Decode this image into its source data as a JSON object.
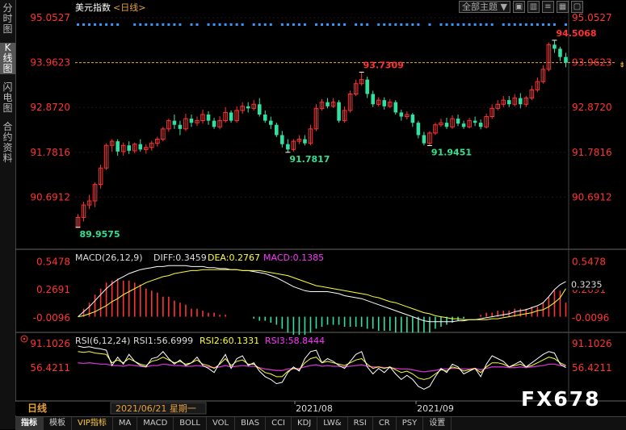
{
  "sidebar": {
    "items": [
      {
        "label": "分时图",
        "active": false
      },
      {
        "label": "K线图",
        "active": true
      },
      {
        "label": "闪电图",
        "active": false
      },
      {
        "label": "合约资料",
        "active": false
      }
    ]
  },
  "header": {
    "instrument": "美元指数",
    "period_tag": "<日线>",
    "theme_select": "全部主题",
    "theme_arrow": "▼"
  },
  "footer": {
    "period": "日线",
    "date_readout": "2021/06/21 星期一",
    "month_labels": [
      "2021/08",
      "2021/09"
    ]
  },
  "bottom_tabs": [
    "指标",
    "模板",
    "VIP指标",
    "MA",
    "MACD",
    "BOLL",
    "VOL",
    "BIAS",
    "CCI",
    "KDJ",
    "LW&",
    "RSI",
    "CR",
    "PSY",
    "设置"
  ],
  "watermark": "FX678",
  "colors": {
    "up": "#ff3333",
    "down": "#33e0a0",
    "up_label": "#ff3333",
    "down_label": "#33e08f",
    "price_axis": "#ff3333",
    "grid": "#3a1a1a",
    "cursor": "#e6a23c",
    "diff": "#ffffff",
    "dea": "#ffff33",
    "macd": "#cc33cc",
    "macd_label": "#ff33ff",
    "rsi1": "#ffffff",
    "rsi2": "#ffff33",
    "rsi3": "#cc33cc"
  },
  "chart_data": [
    {
      "type": "candlestick",
      "yticks": [
        "95.0527",
        "93.9623",
        "92.8720",
        "91.7816",
        "90.6912"
      ],
      "ylim": [
        89.6,
        95.25
      ],
      "last_price_label": "93.9623",
      "annotations": [
        {
          "text": "89.9575",
          "value": 89.9575
        },
        {
          "text": "91.7817",
          "value": 91.7817
        },
        {
          "text": "93.7309",
          "value": 93.7309
        },
        {
          "text": "91.9451",
          "value": 91.9451
        },
        {
          "text": "94.5068",
          "value": 94.5068
        }
      ],
      "candles": [
        [
          89.96,
          90.2,
          90.28,
          89.95
        ],
        [
          90.2,
          90.5,
          90.58,
          90.1
        ],
        [
          90.5,
          90.6,
          90.75,
          90.4
        ],
        [
          90.6,
          91.0,
          91.05,
          90.45
        ],
        [
          91.0,
          91.4,
          91.48,
          90.9
        ],
        [
          91.4,
          91.95,
          92.0,
          91.35
        ],
        [
          91.95,
          92.05,
          92.1,
          91.8
        ],
        [
          92.05,
          91.8,
          92.1,
          91.7
        ],
        [
          91.8,
          91.95,
          92.02,
          91.7
        ],
        [
          91.95,
          91.82,
          92.05,
          91.74
        ],
        [
          91.82,
          91.98,
          92.02,
          91.76
        ],
        [
          91.98,
          91.85,
          92.1,
          91.8
        ],
        [
          91.85,
          91.9,
          91.98,
          91.75
        ],
        [
          91.9,
          92.0,
          92.06,
          91.82
        ],
        [
          92.0,
          92.1,
          92.16,
          91.92
        ],
        [
          92.1,
          92.35,
          92.4,
          92.05
        ],
        [
          92.35,
          92.55,
          92.6,
          92.28
        ],
        [
          92.55,
          92.45,
          92.7,
          92.35
        ],
        [
          92.45,
          92.35,
          92.55,
          92.2
        ],
        [
          92.35,
          92.6,
          92.72,
          92.3
        ],
        [
          92.6,
          92.5,
          92.7,
          92.4
        ],
        [
          92.5,
          92.55,
          92.65,
          92.42
        ],
        [
          92.55,
          92.7,
          92.82,
          92.48
        ],
        [
          92.7,
          92.55,
          92.78,
          92.45
        ],
        [
          92.55,
          92.4,
          92.62,
          92.35
        ],
        [
          92.4,
          92.55,
          92.66,
          92.34
        ],
        [
          92.55,
          92.75,
          92.88,
          92.5
        ],
        [
          92.75,
          92.55,
          92.8,
          92.5
        ],
        [
          92.55,
          92.8,
          92.9,
          92.5
        ],
        [
          92.8,
          92.9,
          93.0,
          92.72
        ],
        [
          92.9,
          92.85,
          93.0,
          92.75
        ],
        [
          92.85,
          92.95,
          93.05,
          92.8
        ],
        [
          92.95,
          92.7,
          93.1,
          92.65
        ],
        [
          92.7,
          92.55,
          92.8,
          92.5
        ],
        [
          92.55,
          92.45,
          92.65,
          92.35
        ],
        [
          92.45,
          92.2,
          92.5,
          92.15
        ],
        [
          92.2,
          91.98,
          92.3,
          91.9
        ],
        [
          91.98,
          91.85,
          92.1,
          91.78
        ],
        [
          91.85,
          92.05,
          92.1,
          91.8
        ],
        [
          92.05,
          92.1,
          92.2,
          91.98
        ],
        [
          92.1,
          92.0,
          92.2,
          91.95
        ],
        [
          92.0,
          92.35,
          92.45,
          91.95
        ],
        [
          92.35,
          92.85,
          92.95,
          92.3
        ],
        [
          92.85,
          93.0,
          93.08,
          92.8
        ],
        [
          93.0,
          92.9,
          93.1,
          92.85
        ],
        [
          92.9,
          93.0,
          93.1,
          92.86
        ],
        [
          93.0,
          92.55,
          93.05,
          92.5
        ],
        [
          92.55,
          92.8,
          92.9,
          92.5
        ],
        [
          92.8,
          93.2,
          93.28,
          92.75
        ],
        [
          93.2,
          93.45,
          93.55,
          93.15
        ],
        [
          93.45,
          93.55,
          93.73,
          93.4
        ],
        [
          93.55,
          93.2,
          93.62,
          93.1
        ],
        [
          93.2,
          92.95,
          93.28,
          92.88
        ],
        [
          92.95,
          93.05,
          93.12,
          92.9
        ],
        [
          93.05,
          92.9,
          93.12,
          92.82
        ],
        [
          92.9,
          93.0,
          93.08,
          92.86
        ],
        [
          93.0,
          92.75,
          93.05,
          92.7
        ],
        [
          92.75,
          92.65,
          92.82,
          92.55
        ],
        [
          92.65,
          92.7,
          92.78,
          92.58
        ],
        [
          92.7,
          92.5,
          92.74,
          92.4
        ],
        [
          92.5,
          92.2,
          92.55,
          92.12
        ],
        [
          92.2,
          92.0,
          92.28,
          91.95
        ],
        [
          92.0,
          92.25,
          92.3,
          91.945
        ],
        [
          92.25,
          92.45,
          92.5,
          92.2
        ],
        [
          92.45,
          92.5,
          92.6,
          92.4
        ],
        [
          92.5,
          92.4,
          92.62,
          92.35
        ],
        [
          92.4,
          92.6,
          92.68,
          92.35
        ],
        [
          92.6,
          92.48,
          92.7,
          92.42
        ],
        [
          92.48,
          92.4,
          92.55,
          92.35
        ],
        [
          92.4,
          92.55,
          92.62,
          92.36
        ],
        [
          92.55,
          92.5,
          92.65,
          92.42
        ],
        [
          92.5,
          92.4,
          92.58,
          92.34
        ],
        [
          92.4,
          92.65,
          92.72,
          92.36
        ],
        [
          92.65,
          92.85,
          92.95,
          92.6
        ],
        [
          92.85,
          92.95,
          93.05,
          92.8
        ],
        [
          92.95,
          93.05,
          93.15,
          92.88
        ],
        [
          93.05,
          92.95,
          93.15,
          92.88
        ],
        [
          92.95,
          93.1,
          93.2,
          92.9
        ],
        [
          93.1,
          92.95,
          93.22,
          92.85
        ],
        [
          92.95,
          93.1,
          93.15,
          92.88
        ],
        [
          93.1,
          93.3,
          93.4,
          93.05
        ],
        [
          93.3,
          93.5,
          93.6,
          93.25
        ],
        [
          93.5,
          93.8,
          93.9,
          93.45
        ],
        [
          93.8,
          94.4,
          94.45,
          93.75
        ],
        [
          94.4,
          94.3,
          94.5068,
          94.2
        ],
        [
          94.3,
          94.1,
          94.35,
          94.0
        ],
        [
          94.1,
          93.96,
          94.2,
          93.85
        ]
      ]
    },
    {
      "type": "macd",
      "name": "MACD(26,12,9)",
      "readouts": {
        "diff": "DIFF:0.3459",
        "dea": "DEA:0.2767",
        "macd": "MACD:0.1385"
      },
      "yticks": [
        "0.5478",
        "0.2691",
        "-0.0096"
      ],
      "right_value": "0.3235",
      "ylim": [
        -0.14,
        0.6
      ],
      "diff": [
        0.0,
        0.05,
        0.1,
        0.16,
        0.22,
        0.28,
        0.33,
        0.37,
        0.4,
        0.43,
        0.45,
        0.47,
        0.48,
        0.49,
        0.5,
        0.5,
        0.51,
        0.51,
        0.51,
        0.51,
        0.5,
        0.5,
        0.5,
        0.49,
        0.49,
        0.48,
        0.48,
        0.47,
        0.47,
        0.46,
        0.46,
        0.45,
        0.44,
        0.43,
        0.41,
        0.39,
        0.36,
        0.33,
        0.3,
        0.28,
        0.26,
        0.25,
        0.25,
        0.25,
        0.25,
        0.24,
        0.23,
        0.21,
        0.2,
        0.19,
        0.18,
        0.16,
        0.14,
        0.12,
        0.1,
        0.08,
        0.06,
        0.04,
        0.02,
        0.0,
        -0.02,
        -0.04,
        -0.05,
        -0.05,
        -0.05,
        -0.05,
        -0.05,
        -0.04,
        -0.04,
        -0.03,
        -0.03,
        -0.02,
        -0.01,
        0.0,
        0.01,
        0.02,
        0.03,
        0.05,
        0.06,
        0.07,
        0.09,
        0.11,
        0.14,
        0.2,
        0.27,
        0.32,
        0.35
      ],
      "dea": [
        0.0,
        0.01,
        0.03,
        0.05,
        0.08,
        0.11,
        0.15,
        0.18,
        0.22,
        0.25,
        0.28,
        0.31,
        0.34,
        0.36,
        0.38,
        0.4,
        0.41,
        0.43,
        0.44,
        0.45,
        0.46,
        0.46,
        0.47,
        0.47,
        0.47,
        0.47,
        0.47,
        0.47,
        0.47,
        0.46,
        0.46,
        0.46,
        0.46,
        0.45,
        0.44,
        0.43,
        0.42,
        0.41,
        0.39,
        0.37,
        0.35,
        0.33,
        0.31,
        0.3,
        0.29,
        0.28,
        0.27,
        0.26,
        0.25,
        0.24,
        0.23,
        0.22,
        0.2,
        0.19,
        0.17,
        0.15,
        0.14,
        0.12,
        0.1,
        0.08,
        0.06,
        0.04,
        0.03,
        0.01,
        0.0,
        -0.01,
        -0.02,
        -0.02,
        -0.03,
        -0.03,
        -0.03,
        -0.03,
        -0.03,
        -0.02,
        -0.02,
        -0.01,
        0.0,
        0.01,
        0.02,
        0.03,
        0.04,
        0.06,
        0.07,
        0.1,
        0.14,
        0.19,
        0.28
      ],
      "macd": [
        0.0,
        0.08,
        0.14,
        0.22,
        0.28,
        0.34,
        0.36,
        0.38,
        0.36,
        0.36,
        0.34,
        0.32,
        0.28,
        0.26,
        0.24,
        0.2,
        0.2,
        0.16,
        0.14,
        0.12,
        0.08,
        0.08,
        0.06,
        0.04,
        0.04,
        0.02,
        0.02,
        0.0,
        0.0,
        0.0,
        0.0,
        -0.02,
        -0.04,
        -0.04,
        -0.06,
        -0.08,
        -0.12,
        -0.16,
        -0.18,
        -0.18,
        -0.18,
        -0.16,
        -0.12,
        -0.1,
        -0.08,
        -0.08,
        -0.08,
        -0.1,
        -0.1,
        -0.1,
        -0.1,
        -0.12,
        -0.12,
        -0.14,
        -0.14,
        -0.14,
        -0.16,
        -0.16,
        -0.16,
        -0.16,
        -0.16,
        -0.16,
        -0.16,
        -0.12,
        -0.1,
        -0.08,
        -0.06,
        -0.04,
        -0.02,
        0.0,
        0.0,
        0.02,
        0.04,
        0.04,
        0.06,
        0.06,
        0.06,
        0.08,
        0.08,
        0.08,
        0.1,
        0.1,
        0.14,
        0.2,
        0.26,
        0.26,
        0.14
      ]
    },
    {
      "type": "rsi",
      "name": "RSI(6,12,24)",
      "readouts": {
        "rsi1": "RSI1:56.6999",
        "rsi2": "RSI2:60.1331",
        "rsi3": "RSI3:58.8444"
      },
      "yticks": [
        "91.1026",
        "56.4211"
      ],
      "ylim": [
        15,
        96
      ],
      "rsi1": [
        88,
        86,
        87,
        85,
        84,
        82,
        60,
        72,
        62,
        76,
        66,
        60,
        58,
        70,
        72,
        80,
        70,
        62,
        68,
        60,
        64,
        72,
        60,
        56,
        50,
        64,
        76,
        56,
        70,
        74,
        60,
        64,
        52,
        44,
        40,
        34,
        36,
        50,
        58,
        52,
        70,
        80,
        82,
        64,
        70,
        66,
        60,
        56,
        66,
        76,
        80,
        58,
        48,
        56,
        50,
        58,
        48,
        40,
        46,
        40,
        30,
        26,
        30,
        44,
        56,
        50,
        62,
        58,
        48,
        52,
        56,
        44,
        62,
        74,
        70,
        66,
        58,
        62,
        66,
        58,
        64,
        70,
        76,
        80,
        78,
        62,
        57
      ],
      "rsi2": [
        80,
        79,
        80,
        78,
        77,
        76,
        64,
        68,
        64,
        70,
        66,
        62,
        60,
        66,
        68,
        72,
        68,
        64,
        66,
        62,
        64,
        68,
        62,
        60,
        56,
        62,
        70,
        60,
        66,
        68,
        62,
        62,
        56,
        50,
        48,
        44,
        44,
        52,
        56,
        54,
        64,
        70,
        72,
        64,
        66,
        64,
        62,
        60,
        64,
        68,
        70,
        62,
        56,
        58,
        56,
        58,
        54,
        50,
        52,
        48,
        42,
        40,
        42,
        48,
        54,
        52,
        58,
        56,
        52,
        54,
        56,
        50,
        58,
        64,
        64,
        62,
        58,
        60,
        62,
        58,
        60,
        64,
        68,
        72,
        70,
        64,
        60
      ],
      "rsi3": [
        64,
        63,
        64,
        63,
        62,
        62,
        60,
        60,
        59,
        61,
        60,
        59,
        58,
        60,
        60,
        62,
        61,
        60,
        60,
        59,
        59,
        60,
        59,
        58,
        57,
        58,
        60,
        58,
        59,
        60,
        59,
        59,
        57,
        55,
        54,
        53,
        53,
        55,
        56,
        56,
        58,
        60,
        61,
        59,
        60,
        59,
        59,
        58,
        59,
        60,
        61,
        59,
        58,
        58,
        57,
        57,
        56,
        55,
        55,
        54,
        52,
        51,
        52,
        53,
        55,
        55,
        56,
        56,
        55,
        55,
        56,
        54,
        56,
        58,
        58,
        58,
        57,
        57,
        58,
        57,
        58,
        59,
        60,
        62,
        62,
        60,
        59
      ]
    }
  ]
}
